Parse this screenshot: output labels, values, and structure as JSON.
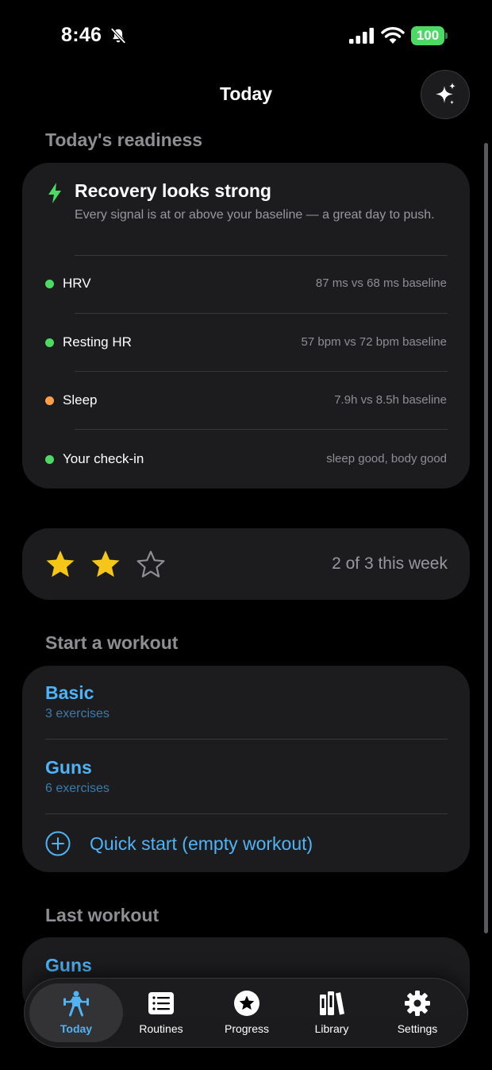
{
  "status_bar": {
    "time": "8:46",
    "battery": "100"
  },
  "nav": {
    "title": "Today"
  },
  "readiness": {
    "section_title": "Today's readiness",
    "headline": "Recovery looks strong",
    "subtitle": "Every signal is at or above your baseline — a great day to push.",
    "metrics": [
      {
        "label": "HRV",
        "value": "87 ms vs 68 ms baseline",
        "status_color": "#4cd964"
      },
      {
        "label": "Resting HR",
        "value": "57 bpm vs 72 bpm baseline",
        "status_color": "#4cd964"
      },
      {
        "label": "Sleep",
        "value": "7.9h vs 8.5h baseline",
        "status_color": "#ff9f4a"
      },
      {
        "label": "Your check-in",
        "value": "sleep good, body good",
        "status_color": "#4cd964"
      }
    ]
  },
  "weekly_goal": {
    "stars_filled": 2,
    "stars_total": 3,
    "text": "2 of 3 this week"
  },
  "workouts": {
    "section_title": "Start a workout",
    "routines": [
      {
        "name": "Basic",
        "count": "3 exercises"
      },
      {
        "name": "Guns",
        "count": "6 exercises"
      }
    ],
    "quick_start": "Quick start (empty workout)"
  },
  "last_workout": {
    "section_title": "Last workout",
    "name": "Guns"
  },
  "tabs": [
    {
      "label": "Today",
      "icon": "weightlifter-icon",
      "active": true
    },
    {
      "label": "Routines",
      "icon": "list-icon",
      "active": false
    },
    {
      "label": "Progress",
      "icon": "star-circle-icon",
      "active": false
    },
    {
      "label": "Library",
      "icon": "books-icon",
      "active": false
    },
    {
      "label": "Settings",
      "icon": "gear-icon",
      "active": false
    }
  ],
  "colors": {
    "accent": "#4fb3f5",
    "good": "#4cd964",
    "warn": "#ff9f4a",
    "star": "#f5c518"
  }
}
